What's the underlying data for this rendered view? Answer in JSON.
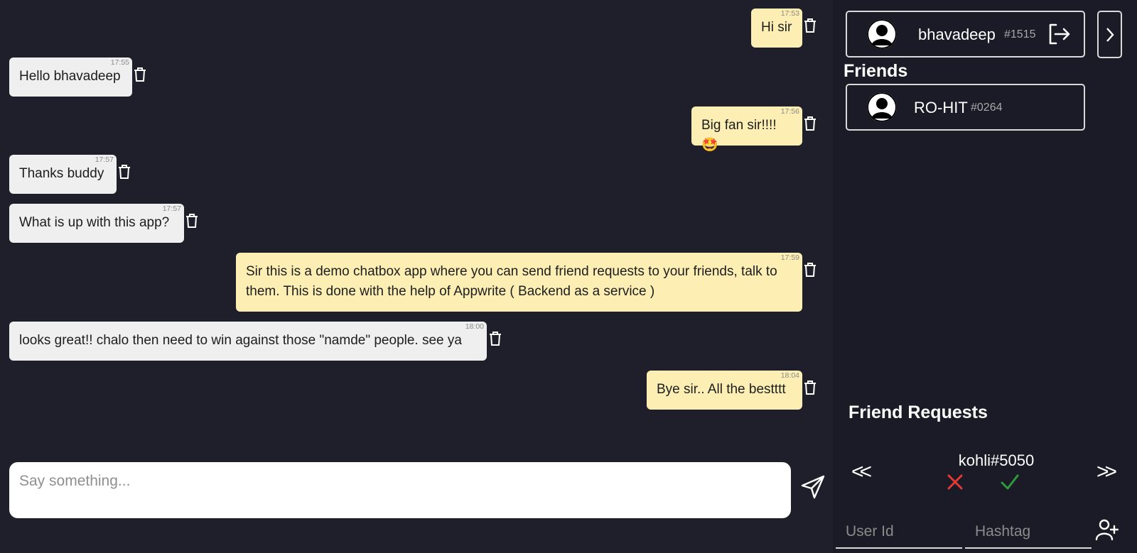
{
  "messages": [
    {
      "side": "mine",
      "text": "Hi sir",
      "time": "17:53"
    },
    {
      "side": "theirs",
      "text": "Hello bhavadeep",
      "time": "17:55"
    },
    {
      "side": "mine",
      "text": "Big fan sir!!!!🤩",
      "time": "17:56"
    },
    {
      "side": "theirs",
      "text": "Thanks buddy",
      "time": "17:57"
    },
    {
      "side": "theirs",
      "text": "What is up with this app?",
      "time": "17:57"
    },
    {
      "side": "mine",
      "text": "Sir this is a demo chatbox app where you can send friend requests to your friends, talk to them. This is done with the help of Appwrite ( Backend as a service )",
      "time": "17:59"
    },
    {
      "side": "theirs",
      "text": "looks great!! chalo then need to win against those \"namde\" people. see ya",
      "time": "18:00"
    },
    {
      "side": "mine",
      "text": "Bye sir.. All the bestttt",
      "time": "18:04"
    }
  ],
  "composer": {
    "placeholder": "Say something..."
  },
  "current_user": {
    "name": "bhavadeep",
    "tag": "#1515"
  },
  "friends": {
    "title": "Friends",
    "items": [
      {
        "name": "RO-HIT",
        "tag": "#0264"
      }
    ]
  },
  "friend_requests": {
    "title": "Friend Requests",
    "current": "kohli#5050",
    "prev_label": "<<",
    "next_label": ">>"
  },
  "add_friend": {
    "user_id_placeholder": "User Id",
    "hashtag_placeholder": "Hashtag"
  },
  "colors": {
    "background": "#1e1f2b",
    "panel": "#1a1b26",
    "my_bubble": "#fdefb3",
    "their_bubble": "#efefef",
    "reject": "#e53935",
    "accept": "#2e9b3a"
  }
}
